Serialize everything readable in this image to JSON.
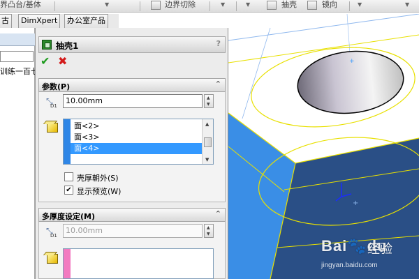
{
  "toolbar": {
    "left_label": "界凸台/基体",
    "cut_label": "边界切除",
    "shell_label": "抽壳",
    "mirror_label": "镜向"
  },
  "tabs": [
    {
      "label": "古"
    },
    {
      "label": "DimXpert"
    },
    {
      "label": "办公室产品"
    }
  ],
  "left_panel": {
    "tree_text": "训练一百七"
  },
  "property_manager": {
    "title": "抽壳1",
    "help": "?",
    "ok_symbol": "✔",
    "cancel_symbol": "✖",
    "parameters": {
      "header": "参数(P)",
      "thickness": "10.00mm",
      "dim_label": "D1",
      "faces": [
        "面<2>",
        "面<3>",
        "面<4>"
      ],
      "selected_face_index": 2,
      "shell_outward": {
        "label": "壳厚朝外(S)",
        "checked": false
      },
      "show_preview": {
        "label": "显示预览(W)",
        "checked": true
      }
    },
    "multi_thickness": {
      "header": "多厚度设定(M)",
      "thickness": "10.00mm",
      "dim_label": "D1"
    }
  },
  "watermark": {
    "logo": "Bai",
    "logo_tail": "du",
    "text": "经验",
    "url": "jingyan.baidu.com"
  },
  "colors": {
    "model_face": "#3a8ee6",
    "model_dark": "#2a4f86",
    "sketch": "#e8e000",
    "selection": "#3399ff"
  }
}
